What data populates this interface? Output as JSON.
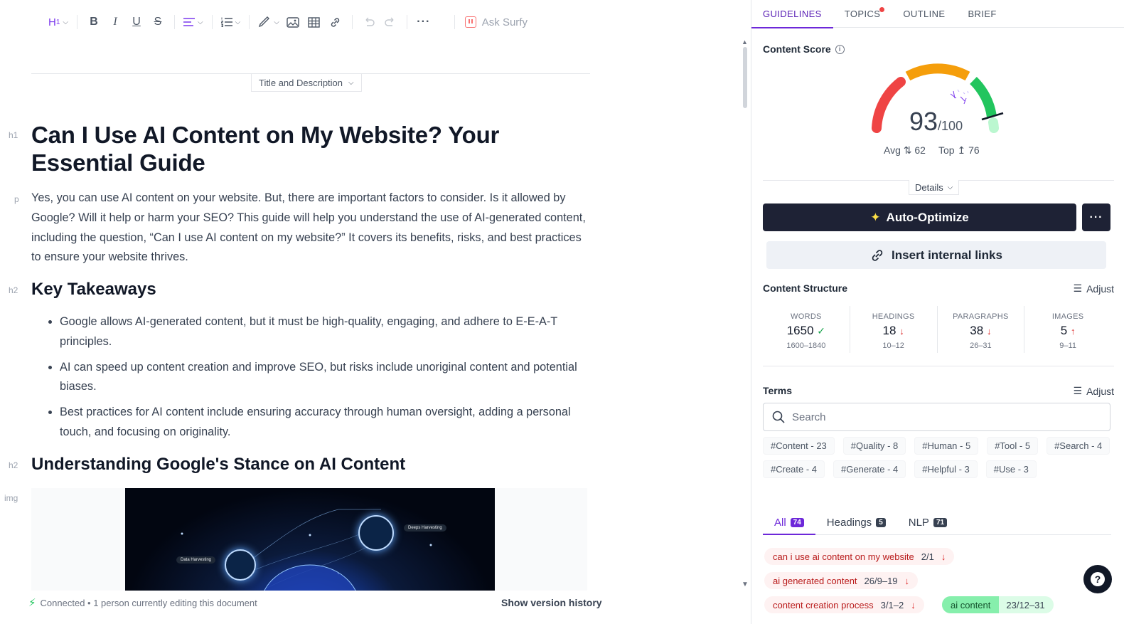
{
  "toolbar": {
    "heading_label": "H",
    "heading_sub": "1",
    "bold": "B",
    "italic": "I",
    "underline": "U",
    "strike": "S",
    "ask_surfy": "Ask Surfy"
  },
  "title_desc_tab": "Title and Description",
  "document": {
    "h1_tag": "h1",
    "h1": "Can I Use AI Content on My Website? Your Essential Guide",
    "p_tag": "p",
    "intro": "Yes, you can use AI content on your website. But, there are important factors to consider. Is it allowed by Google? Will it help or harm your SEO? This guide will help you understand the use of AI-generated content, including the question, “Can I use AI content on my website?” It covers its benefits, risks, and best practices to ensure your website thrives.",
    "h2_tag": "h2",
    "h2_key": "Key Takeaways",
    "bullets": [
      "Google allows AI-generated content, but it must be high-quality, engaging, and adhere to E-E-A-T principles.",
      "AI can speed up content creation and improve SEO, but risks include unoriginal content and potential biases.",
      "Best practices for AI content include ensuring accuracy through human oversight, adding a personal touch, and focusing on originality."
    ],
    "h2_google": "Understanding Google's Stance on AI Content",
    "img_tag": "img",
    "img_label_left": "Data Harvesting",
    "img_label_right": "Deeps Harvesting"
  },
  "status": {
    "connected": "Connected • 1 person currently editing this document",
    "version_history": "Show version history"
  },
  "panel": {
    "tabs": [
      "GUIDELINES",
      "TOPICS",
      "OUTLINE",
      "BRIEF"
    ],
    "content_score_title": "Content Score",
    "score": "93",
    "score_max": "/100",
    "avg_label": "Avg",
    "avg_value": "62",
    "top_label": "Top",
    "top_value": "76",
    "details": "Details",
    "auto_optimize": "Auto-Optimize",
    "insert_links": "Insert internal links",
    "structure_title": "Content Structure",
    "adjust": "Adjust",
    "stats": [
      {
        "label": "WORDS",
        "value": "1650",
        "range": "1600–1840"
      },
      {
        "label": "HEADINGS",
        "value": "18",
        "range": "10–12"
      },
      {
        "label": "PARAGRAPHS",
        "value": "38",
        "range": "26–31"
      },
      {
        "label": "IMAGES",
        "value": "5",
        "range": "9–11"
      }
    ],
    "terms_title": "Terms",
    "search_placeholder": "Search",
    "chips": [
      "#Content - 23",
      "#Quality - 8",
      "#Human - 5",
      "#Tool - 5",
      "#Search - 4",
      "#Create - 4",
      "#Generate - 4",
      "#Helpful - 3",
      "#Use - 3"
    ],
    "subtabs": [
      {
        "label": "All",
        "count": "74"
      },
      {
        "label": "Headings",
        "count": "5"
      },
      {
        "label": "NLP",
        "count": "71"
      }
    ],
    "terms": [
      {
        "label": "can i use ai content on my website",
        "count": "2/1"
      },
      {
        "label": "ai generated content",
        "count": "26/9–19"
      },
      {
        "label": "content creation process",
        "count": "3/1–2"
      },
      {
        "label": "ai content",
        "count": "23/12–31"
      }
    ]
  },
  "colors": {
    "accent": "#6d28d9",
    "dark_button": "#1e2235",
    "gauge_red": "#ef4444",
    "gauge_orange": "#f59e0b",
    "gauge_green": "#22c55e"
  }
}
